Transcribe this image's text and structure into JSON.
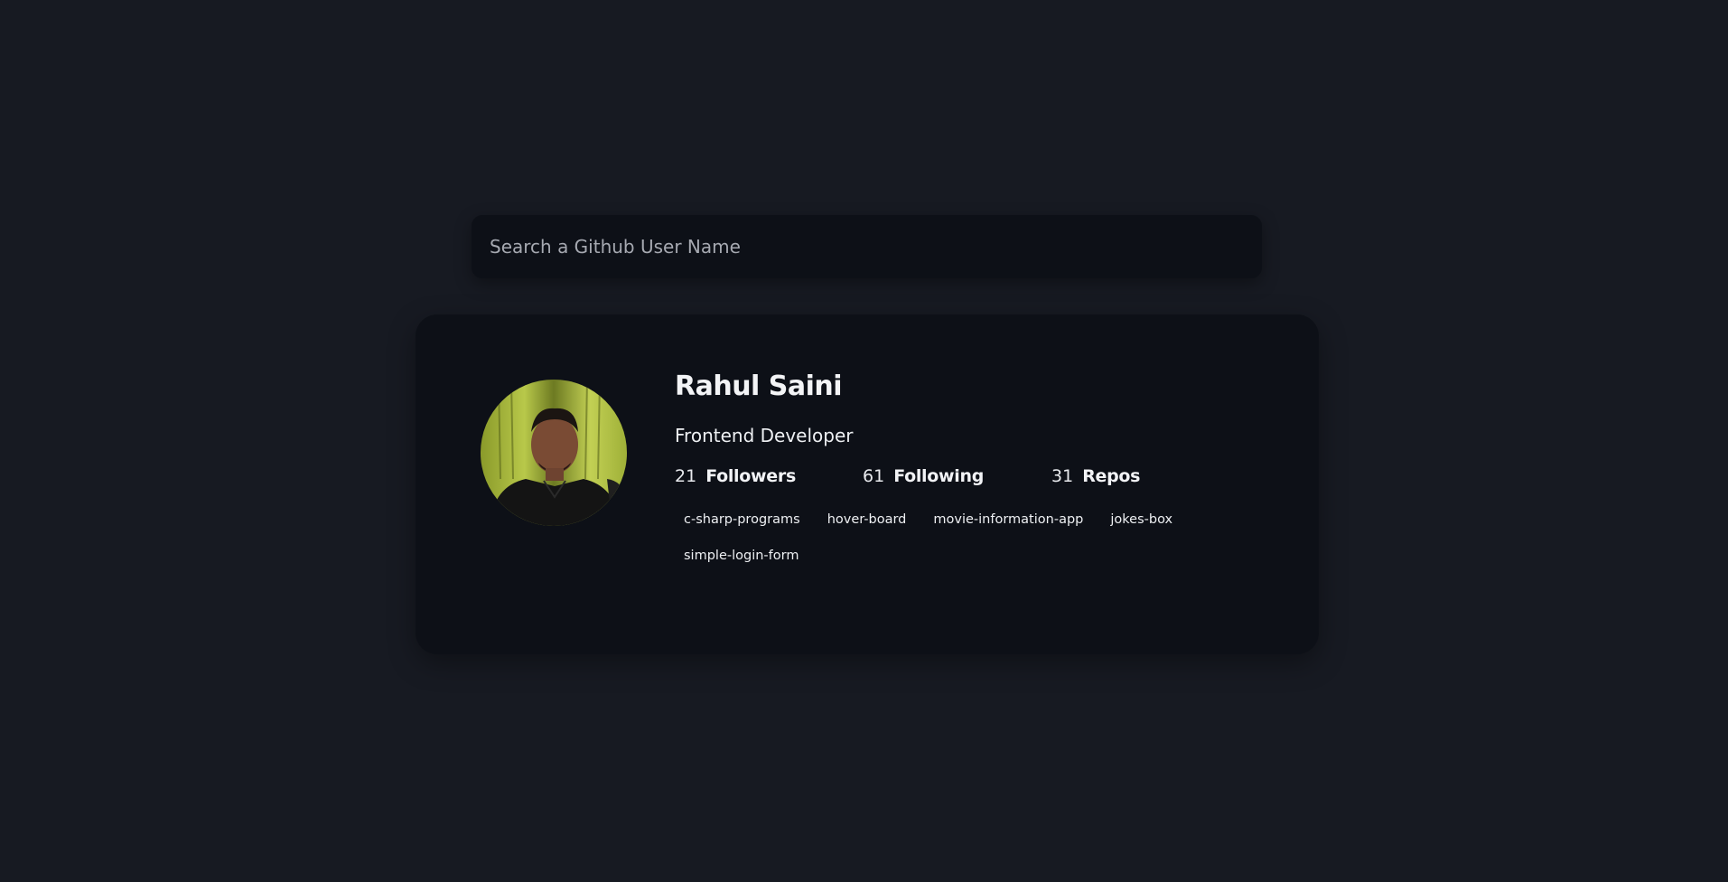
{
  "search": {
    "placeholder": "Search a Github User Name",
    "value": ""
  },
  "profile": {
    "name": "Rahul Saini",
    "bio": "Frontend Developer",
    "avatar_icon": "user-avatar-photo",
    "stats": [
      {
        "count": "21",
        "label": "Followers"
      },
      {
        "count": "61",
        "label": "Following"
      },
      {
        "count": "31",
        "label": "Repos"
      }
    ],
    "repos": [
      "c-sharp-programs",
      "hover-board",
      "movie-information-app",
      "jokes-box",
      "simple-login-form"
    ]
  },
  "colors": {
    "background": "#171a22",
    "card": "#0d1017",
    "text": "#f0f2f5"
  }
}
